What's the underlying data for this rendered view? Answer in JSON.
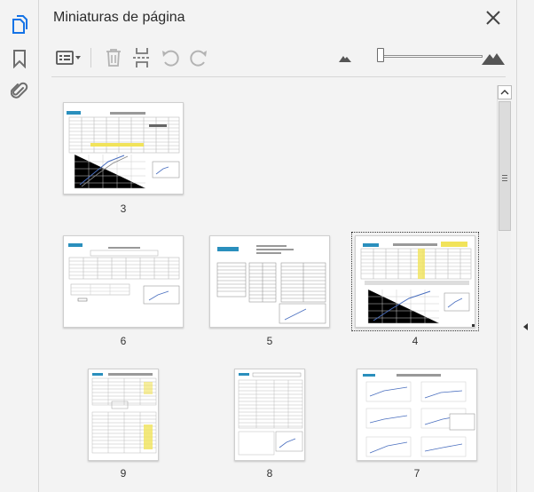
{
  "panel": {
    "title": "Miniaturas de página"
  },
  "colors": {
    "accent": "#1473e6",
    "icon": "#6e6e6e",
    "icon_disabled": "#b3b3b3"
  },
  "rail": {
    "items": [
      {
        "name": "page-thumbnails",
        "icon": "pages-icon",
        "active": true
      },
      {
        "name": "bookmarks",
        "icon": "bookmark-icon",
        "active": false
      },
      {
        "name": "attachments",
        "icon": "paperclip-icon",
        "active": false
      }
    ]
  },
  "toolbar": {
    "options_icon": "options-menu-icon",
    "delete_icon": "trash-icon",
    "insert_icon": "insert-pages-icon",
    "rotate_ccw_icon": "rotate-counterclockwise-icon",
    "rotate_cw_icon": "rotate-clockwise-icon",
    "zoom_out_icon": "small-mountain-icon",
    "zoom_in_icon": "large-mountain-icon",
    "zoom_level": 0
  },
  "thumbnails": [
    {
      "page": "3",
      "orientation": "landscape",
      "selected": false
    },
    {
      "page": "6",
      "orientation": "landscape",
      "selected": false
    },
    {
      "page": "5",
      "orientation": "landscape",
      "selected": false
    },
    {
      "page": "4",
      "orientation": "landscape",
      "selected": true
    },
    {
      "page": "9",
      "orientation": "portrait",
      "selected": false
    },
    {
      "page": "8",
      "orientation": "portrait",
      "selected": false
    },
    {
      "page": "7",
      "orientation": "portrait",
      "selected": false
    }
  ]
}
